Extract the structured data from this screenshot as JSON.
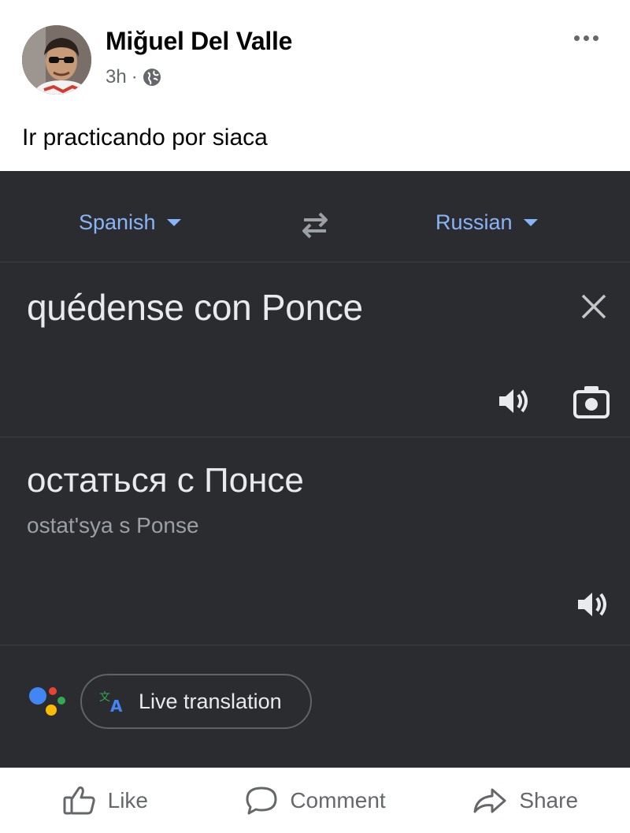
{
  "post": {
    "author": "Miğuel Del Valle",
    "time": "3h",
    "separator": "·",
    "text": "Ir practicando por siaca"
  },
  "translate": {
    "source_lang": "Spanish",
    "target_lang": "Russian",
    "input_text": "quédense con Ponce",
    "output_text": "остаться с Понсе",
    "transliteration": "ostat'sya s Ponse",
    "live_translation_label": "Live translation",
    "colors": {
      "background": "#2b2c30",
      "accent": "#8ab4f8",
      "text": "#e8eaed",
      "muted": "#9aa0a6"
    }
  },
  "actions": {
    "like": "Like",
    "comment": "Comment",
    "share": "Share"
  },
  "icons": [
    "globe-icon",
    "more-icon",
    "swap-icon",
    "clear-icon",
    "speaker-icon",
    "camera-icon",
    "assistant-icon",
    "translate-icon",
    "like-icon",
    "comment-icon",
    "share-icon"
  ]
}
